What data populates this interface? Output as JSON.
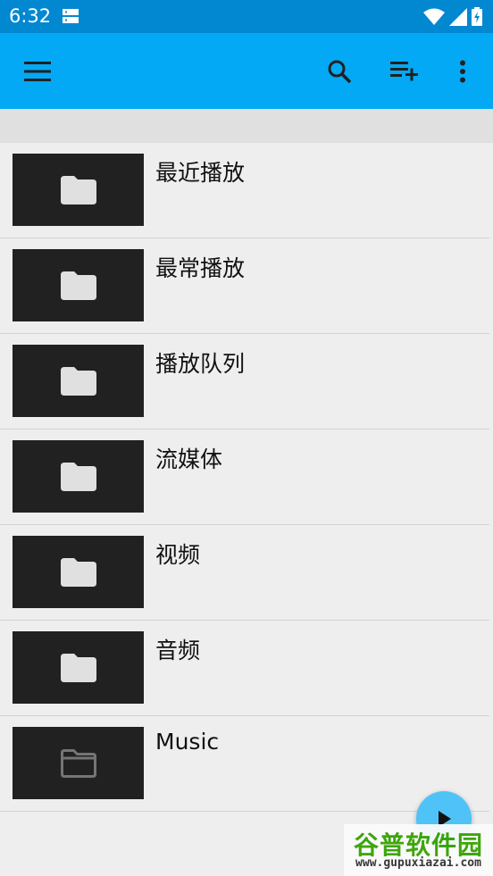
{
  "status_bar": {
    "time": "6:32",
    "icons": [
      "storage-icon",
      "wifi-icon",
      "signal-icon",
      "battery-charging-icon"
    ]
  },
  "toolbar": {
    "menu_icon": "menu-icon",
    "search_icon": "search-icon",
    "add_queue_icon": "playlist-add-icon",
    "more_icon": "more-vert-icon",
    "accent_color": "#03a9f4",
    "status_color": "#0288d1"
  },
  "list": {
    "items": [
      {
        "label": "最近播放",
        "icon": "folder-icon"
      },
      {
        "label": "最常播放",
        "icon": "folder-icon"
      },
      {
        "label": "播放队列",
        "icon": "folder-icon"
      },
      {
        "label": "流媒体",
        "icon": "folder-icon"
      },
      {
        "label": "视频",
        "icon": "folder-icon"
      },
      {
        "label": "音频",
        "icon": "folder-icon"
      },
      {
        "label": "Music",
        "icon": "folder-outline-icon"
      }
    ]
  },
  "fab": {
    "icon": "play-icon"
  },
  "watermark": {
    "title": "谷普软件园",
    "url": "www.gupuxiazai.com"
  }
}
